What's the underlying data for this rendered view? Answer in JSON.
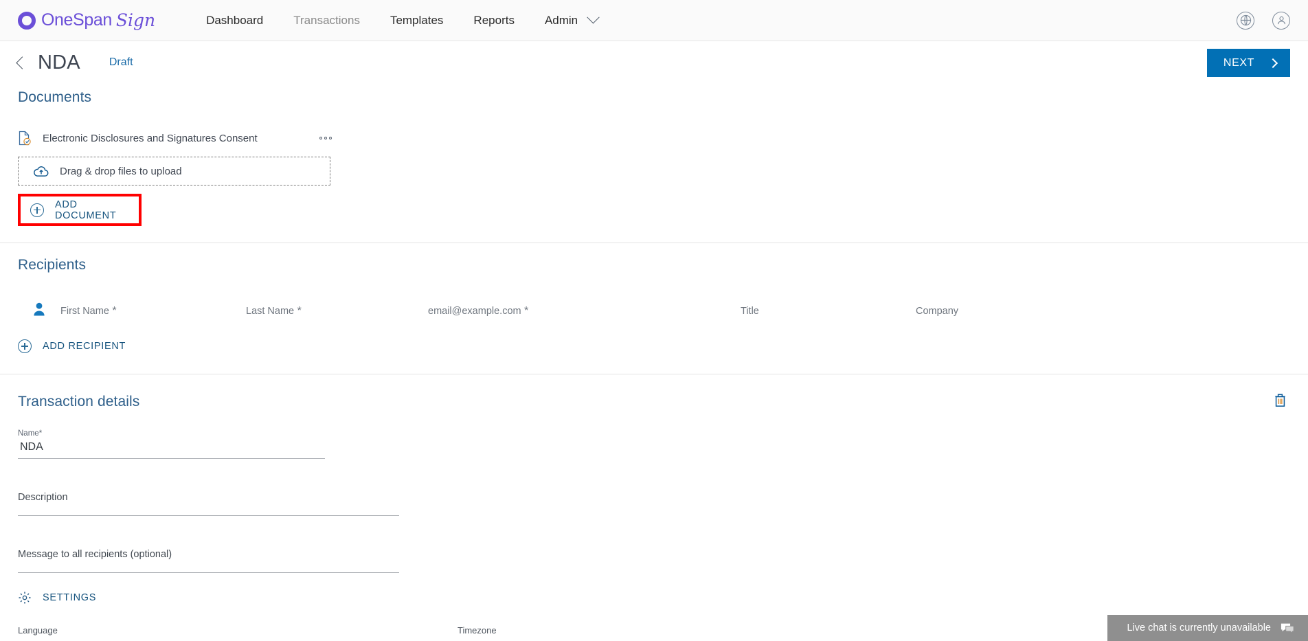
{
  "nav": {
    "logo": {
      "brand": "OneSpan",
      "product": "Sign",
      "icon": "onespan-logo-icon"
    },
    "items": [
      {
        "label": "Dashboard",
        "muted": false
      },
      {
        "label": "Transactions",
        "muted": true
      },
      {
        "label": "Templates",
        "muted": false
      },
      {
        "label": "Reports",
        "muted": false
      },
      {
        "label": "Admin",
        "muted": false,
        "caret": true
      }
    ],
    "right_icons": [
      {
        "name": "globe-icon",
        "glyph": "⊕"
      },
      {
        "name": "account-icon",
        "glyph": "☺"
      }
    ]
  },
  "header": {
    "back_label": "back",
    "title": "NDA",
    "status": "Draft",
    "next_button": "NEXT"
  },
  "documents": {
    "section_title": "Documents",
    "items": [
      {
        "name": "Electronic Disclosures and Signatures Consent",
        "menu": "more-options"
      }
    ],
    "dropzone_label": "Drag & drop files to upload",
    "add_document_label": "ADD DOCUMENT",
    "highlight_color": "#ff0000"
  },
  "recipients": {
    "section_title": "Recipients",
    "fields": [
      {
        "placeholder": "First Name",
        "required": true
      },
      {
        "placeholder": "Last Name",
        "required": true
      },
      {
        "placeholder": "email@example.com",
        "required": true
      },
      {
        "placeholder": "Title",
        "required": false
      },
      {
        "placeholder": "Company",
        "required": false
      }
    ],
    "add_recipient_label": "ADD RECIPIENT"
  },
  "transaction": {
    "section_title": "Transaction details",
    "delete_icon": "trash-icon",
    "name_label": "Name",
    "name_required": "*",
    "name_value": "NDA",
    "description_placeholder": "Description",
    "message_placeholder": "Message to all recipients (optional)",
    "settings_label": "SETTINGS",
    "language_label": "Language",
    "timezone_label": "Timezone"
  },
  "livechat": {
    "message": "Live chat is currently unavailable",
    "icon": "chat-bubble-icon"
  },
  "colors": {
    "brand_purple": "#6b4fd8",
    "accent_blue": "#0270b5",
    "section_heading": "#2e5f8a",
    "link_blue": "#14527d",
    "highlight_red": "#ff0000"
  }
}
